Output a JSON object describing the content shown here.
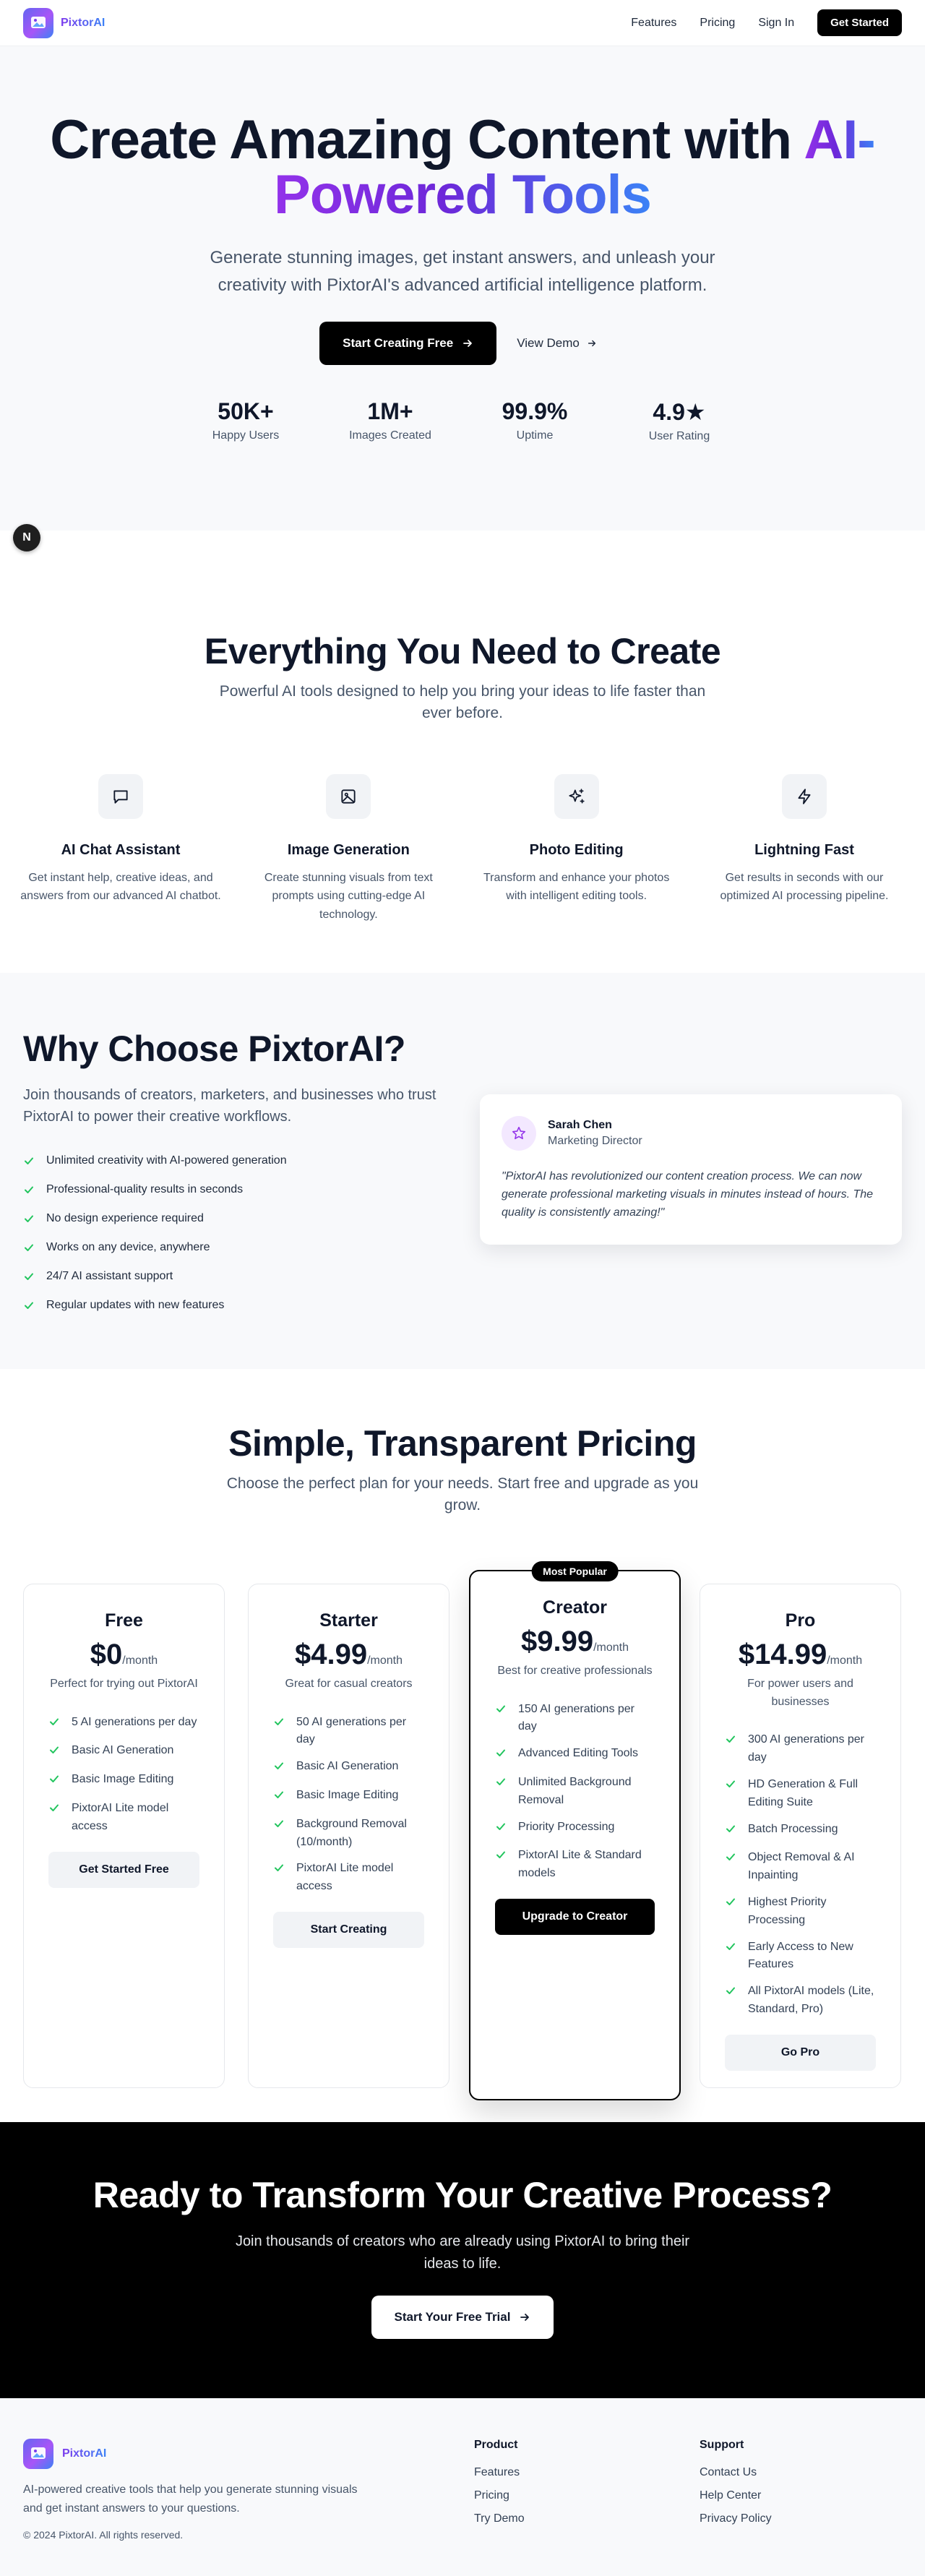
{
  "nav": {
    "brand": "PixtorAI",
    "links": [
      "Features",
      "Pricing",
      "Sign In"
    ],
    "cta": "Get Started"
  },
  "hero": {
    "title_main": "Create Amazing Content with",
    "title_highlight_1": "AI-",
    "title_highlight_2": "Powered Tools",
    "subtitle": "Generate stunning images, get instant answers, and unleash your creativity with PixtorAI's advanced artificial intelligence platform.",
    "primary_cta": "Start Creating Free",
    "secondary_cta": "View Demo",
    "stats": [
      {
        "value": "50K+",
        "label": "Happy Users"
      },
      {
        "value": "1M+",
        "label": "Images Created"
      },
      {
        "value": "99.9%",
        "label": "Uptime"
      },
      {
        "value": "4.9★",
        "label": "User Rating"
      }
    ],
    "badge": "N"
  },
  "features": {
    "title": "Everything You Need to Create",
    "subtitle": "Powerful AI tools designed to help you bring your ideas to life faster than ever before.",
    "items": [
      {
        "icon": "chat-icon",
        "title": "AI Chat Assistant",
        "desc": "Get instant help, creative ideas, and answers from our advanced AI chatbot."
      },
      {
        "icon": "image-icon",
        "title": "Image Generation",
        "desc": "Create stunning visuals from text prompts using cutting-edge AI technology."
      },
      {
        "icon": "sparkles-icon",
        "title": "Photo Editing",
        "desc": "Transform and enhance your photos with intelligent editing tools."
      },
      {
        "icon": "lightning-icon",
        "title": "Lightning Fast",
        "desc": "Get results in seconds with our optimized AI processing pipeline."
      }
    ]
  },
  "why": {
    "title": "Why Choose PixtorAI?",
    "subtitle": "Join thousands of creators, marketers, and businesses who trust PixtorAI to power their creative workflows.",
    "benefits": [
      "Unlimited creativity with AI-powered generation",
      "Professional-quality results in seconds",
      "No design experience required",
      "Works on any device, anywhere",
      "24/7 AI assistant support",
      "Regular updates with new features"
    ],
    "testimonial": {
      "name": "Sarah Chen",
      "role": "Marketing Director",
      "quote": "\"PixtorAI has revolutionized our content creation process. We can now generate professional marketing visuals in minutes instead of hours. The quality is consistently amazing!\""
    }
  },
  "pricing": {
    "title": "Simple, Transparent Pricing",
    "subtitle": "Choose the perfect plan for your needs. Start free and upgrade as you grow.",
    "per": "/month",
    "popular_badge": "Most Popular",
    "plans": [
      {
        "name": "Free",
        "price": "$0",
        "desc": "Perfect for trying out PixtorAI",
        "features": [
          "5 AI generations per day",
          "Basic AI Generation",
          "Basic Image Editing",
          "PixtorAI Lite model access"
        ],
        "cta": "Get Started Free"
      },
      {
        "name": "Starter",
        "price": "$4.99",
        "desc": "Great for casual creators",
        "features": [
          "50 AI generations per day",
          "Basic AI Generation",
          "Basic Image Editing",
          "Background Removal (10/month)",
          "PixtorAI Lite model access"
        ],
        "cta": "Start Creating"
      },
      {
        "name": "Creator",
        "price": "$9.99",
        "desc": "Best for creative professionals",
        "features": [
          "150 AI generations per day",
          "Advanced Editing Tools",
          "Unlimited Background Removal",
          "Priority Processing",
          "PixtorAI Lite & Standard models"
        ],
        "cta": "Upgrade to Creator"
      },
      {
        "name": "Pro",
        "price": "$14.99",
        "desc": "For power users and businesses",
        "features": [
          "300 AI generations per day",
          "HD Generation & Full Editing Suite",
          "Batch Processing",
          "Object Removal & AI Inpainting",
          "Highest Priority Processing",
          "Early Access to New Features",
          "All PixtorAI models (Lite, Standard, Pro)"
        ],
        "cta": "Go Pro"
      }
    ]
  },
  "cta": {
    "title": "Ready to Transform Your Creative Process?",
    "subtitle": "Join thousands of creators who are already using PixtorAI to bring their ideas to life.",
    "button": "Start Your Free Trial"
  },
  "footer": {
    "brand": "PixtorAI",
    "desc": "AI-powered creative tools that help you generate stunning visuals and get instant answers to your questions.",
    "copyright": "© 2024 PixtorAI. All rights reserved.",
    "product_heading": "Product",
    "product_links": [
      "Features",
      "Pricing",
      "Try Demo"
    ],
    "support_heading": "Support",
    "support_links": [
      "Contact Us",
      "Help Center",
      "Privacy Policy"
    ]
  },
  "colors": {
    "accent_purple": "#9333ea",
    "accent_blue": "#3b82f6",
    "check_green": "#22c55e",
    "dark": "#000000"
  }
}
